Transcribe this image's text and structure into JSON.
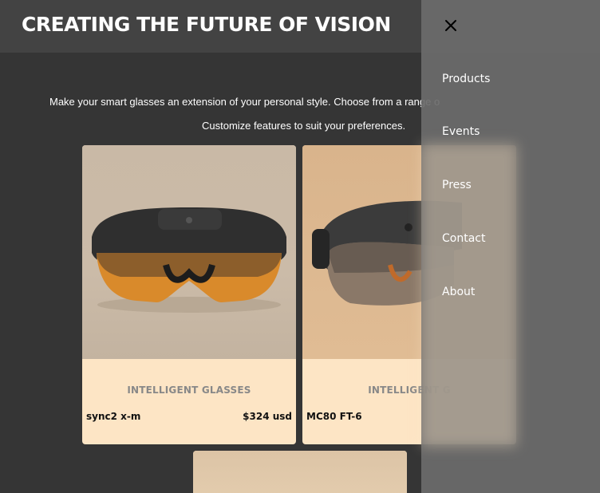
{
  "header": {
    "title": "CREATING THE FUTURE OF VISION"
  },
  "intro": {
    "line1": "Make your smart glasses an extension of your personal style. Choose from a range o",
    "line2": "Customize features to suit your preferences."
  },
  "products": [
    {
      "category": "INTELLIGENT GLASSES",
      "name": "sync2 x-m",
      "price": "$324 usd"
    },
    {
      "category": "INTELLIGENT G",
      "name": "MC80 FT-6",
      "price": ""
    }
  ],
  "menu": {
    "close_icon": "close-icon",
    "items": [
      "Products",
      "Events",
      "Press",
      "Contact",
      "About"
    ]
  }
}
